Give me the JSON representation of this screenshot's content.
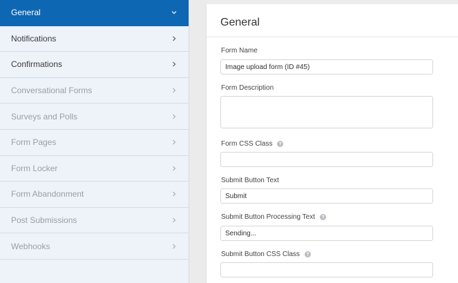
{
  "sidebar": {
    "items": [
      {
        "label": "General",
        "state": "active",
        "icon": "chevron-down-icon"
      },
      {
        "label": "Notifications",
        "state": "strong",
        "icon": "chevron-right-icon"
      },
      {
        "label": "Confirmations",
        "state": "strong",
        "icon": "chevron-right-icon"
      },
      {
        "label": "Conversational Forms",
        "state": "muted",
        "icon": "chevron-right-icon"
      },
      {
        "label": "Surveys and Polls",
        "state": "muted",
        "icon": "chevron-right-icon"
      },
      {
        "label": "Form Pages",
        "state": "muted",
        "icon": "chevron-right-icon"
      },
      {
        "label": "Form Locker",
        "state": "muted",
        "icon": "chevron-right-icon"
      },
      {
        "label": "Form Abandonment",
        "state": "muted",
        "icon": "chevron-right-icon"
      },
      {
        "label": "Post Submissions",
        "state": "muted",
        "icon": "chevron-right-icon"
      },
      {
        "label": "Webhooks",
        "state": "muted",
        "icon": "chevron-right-icon"
      }
    ]
  },
  "panel": {
    "title": "General",
    "fields": {
      "form_name": {
        "label": "Form Name",
        "value": "Image upload form (ID #45)"
      },
      "form_description": {
        "label": "Form Description",
        "value": ""
      },
      "form_css_class": {
        "label": "Form CSS Class",
        "value": "",
        "help_icon": "question-circle-icon"
      },
      "submit_text": {
        "label": "Submit Button Text",
        "value": "Submit"
      },
      "submit_processing_text": {
        "label": "Submit Button Processing Text",
        "value": "Sending...",
        "help_icon": "question-circle-icon"
      },
      "submit_css_class": {
        "label": "Submit Button CSS Class",
        "value": "",
        "help_icon": "question-circle-icon"
      }
    }
  },
  "colors": {
    "active_bg": "#0e67b2",
    "sidebar_bg": "#eef3fa",
    "muted_text": "#9a9ea4"
  }
}
